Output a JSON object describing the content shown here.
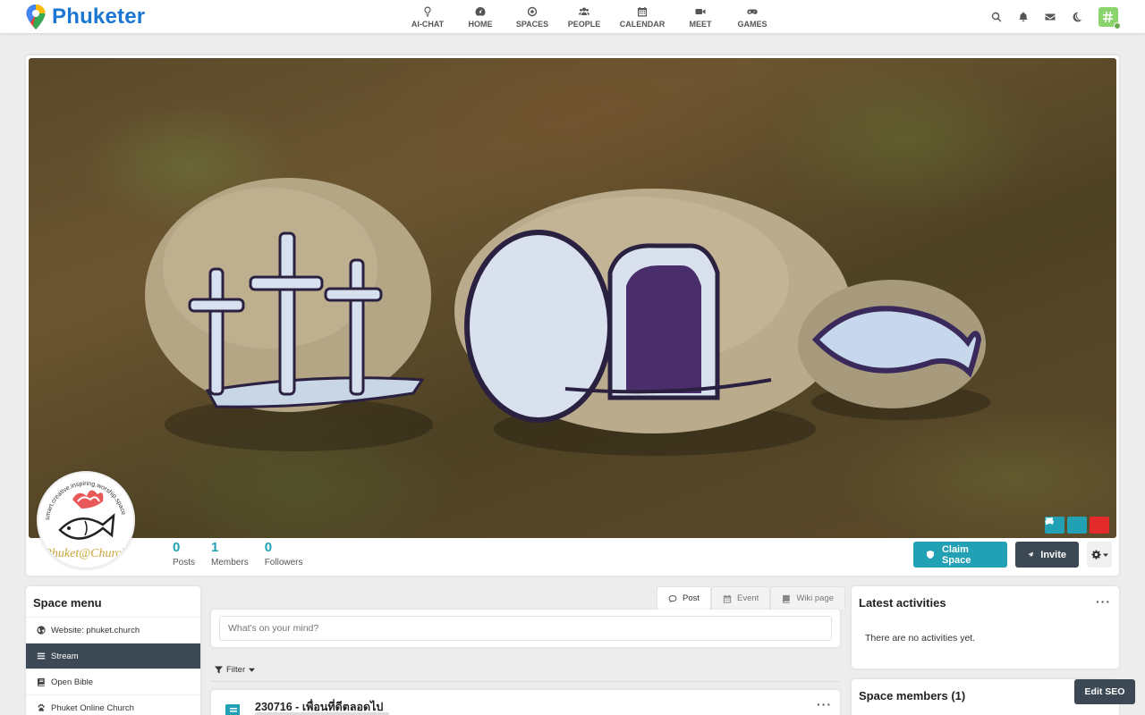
{
  "brand": {
    "name": "Phuketer"
  },
  "nav": [
    {
      "label": "AI-CHAT",
      "icon": "lightbulb-icon"
    },
    {
      "label": "HOME",
      "icon": "dashboard-icon"
    },
    {
      "label": "SPACES",
      "icon": "dot-circle-icon"
    },
    {
      "label": "PEOPLE",
      "icon": "users-icon"
    },
    {
      "label": "CALENDAR",
      "icon": "calendar-icon"
    },
    {
      "label": "MEET",
      "icon": "video-camera-icon"
    },
    {
      "label": "GAMES",
      "icon": "gamepad-icon"
    }
  ],
  "tools": [
    "search-icon",
    "bell-icon",
    "envelope-icon",
    "moon-icon"
  ],
  "space": {
    "counters": [
      {
        "value": "0",
        "label": "Posts"
      },
      {
        "value": "1",
        "label": "Members"
      },
      {
        "value": "0",
        "label": "Followers"
      }
    ],
    "actions": {
      "claim": "Claim Space",
      "invite": "Invite"
    },
    "logo_text": {
      "arc": "smart.creative.inspiring.worship.space",
      "name": "Phuket@Church"
    }
  },
  "space_menu": {
    "title": "Space menu",
    "items": [
      {
        "label": "Website: phuket.church",
        "icon": "globe-icon",
        "active": false
      },
      {
        "label": "Stream",
        "icon": "bars-icon",
        "active": true
      },
      {
        "label": "Open Bible",
        "icon": "book-icon",
        "active": false
      },
      {
        "label": "Phuket Online Church",
        "icon": "paw-icon",
        "active": false
      }
    ]
  },
  "composer": {
    "tabs": [
      {
        "label": "Post",
        "icon": "comment-icon",
        "active": true
      },
      {
        "label": "Event",
        "icon": "calendar-icon",
        "active": false
      },
      {
        "label": "Wiki page",
        "icon": "book-icon",
        "active": false
      }
    ],
    "placeholder": "What's on your mind?"
  },
  "filter": {
    "label": "Filter"
  },
  "post": {
    "title": "230716 - เพื่อนที่ดีตลอดไป"
  },
  "latest": {
    "title": "Latest activities",
    "empty": "There are no activities yet."
  },
  "members": {
    "title": "Space members (1)"
  },
  "edit_seo": "Edit SEO",
  "colors": {
    "accent": "#21a1b3",
    "dark": "#3c4853",
    "danger": "#e32b2b",
    "brand": "#1a76d2"
  }
}
